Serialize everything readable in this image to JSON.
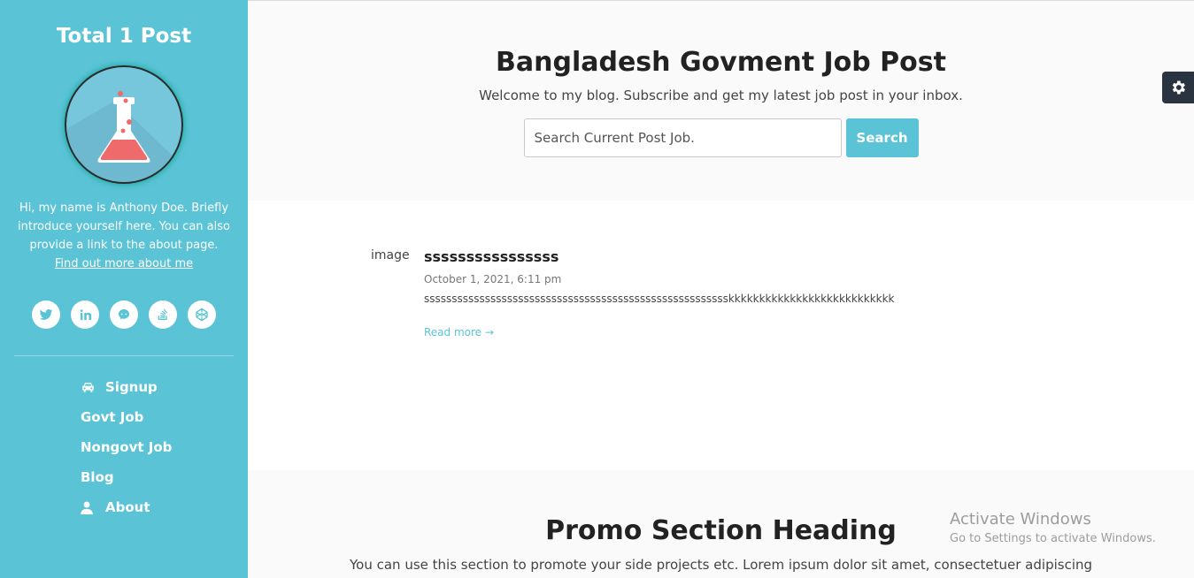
{
  "sidebar": {
    "brand": "Total 1 Post",
    "bio": "Hi, my name is Anthony Doe. Briefly introduce yourself here. You can also provide a link to the about page.",
    "bio_link": "Find out more about me",
    "socials": [
      {
        "icon": "twitter-icon"
      },
      {
        "icon": "linkedin-icon"
      },
      {
        "icon": "github-icon"
      },
      {
        "icon": "stackoverflow-icon"
      },
      {
        "icon": "codepen-icon"
      }
    ],
    "nav": [
      {
        "label": "Signup",
        "icon": "car-icon"
      },
      {
        "label": "Govt Job"
      },
      {
        "label": "Nongovt Job"
      },
      {
        "label": "Blog"
      },
      {
        "label": "About",
        "icon": "user-icon"
      }
    ]
  },
  "header": {
    "title": "Bangladesh Govment Job Post",
    "tagline": "Welcome to my blog. Subscribe and get my latest job post in your inbox.",
    "search_placeholder": "Search Current Post Job.",
    "search_button": "Search"
  },
  "post": {
    "image_alt": "image",
    "title": "ssssssssssssssss",
    "date": "October 1, 2021, 6:11 pm",
    "excerpt": "ssssssssssssssssssssssssssssssssssssssssssssssssssssssskkkkkkkkkkkkkkkkkkkkkkkkkkk",
    "read_more": "Read more →"
  },
  "promo": {
    "heading": "Promo Section Heading",
    "text": "You can use this section to promote your side projects etc. Lorem ipsum dolor sit amet, consectetuer adipiscing"
  },
  "watermark": {
    "title": "Activate Windows",
    "subtitle": "Go to Settings to activate Windows."
  },
  "colors": {
    "accent": "#5bc3d6",
    "settings_bg": "#2a3440"
  }
}
